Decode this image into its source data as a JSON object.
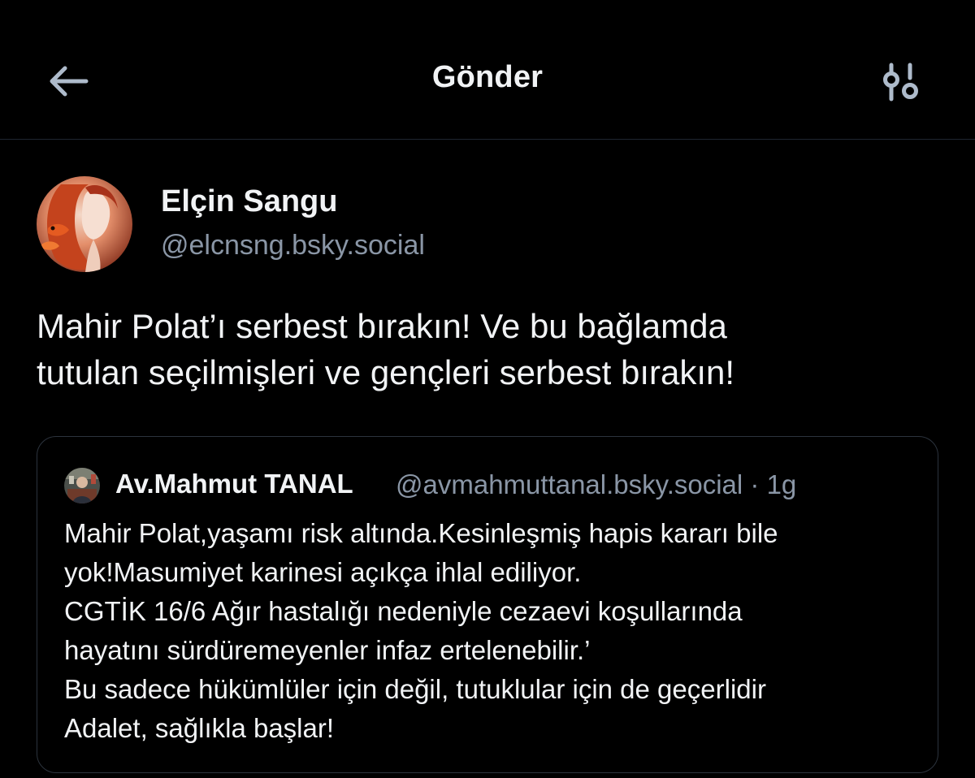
{
  "header": {
    "title": "Gönder",
    "back_icon": "arrow-left-icon",
    "settings_icon": "sliders-icon"
  },
  "post": {
    "author": {
      "display_name": "Elçin Sangu",
      "handle": "@elcnsng.bsky.social"
    },
    "text_lines": [
      "Mahir Polat’ı serbest bırakın! Ve bu bağlamda",
      "tutulan seçilmişleri ve gençleri serbest bırakın!"
    ]
  },
  "quote": {
    "author": {
      "display_name": "Av.Mahmut TANAL",
      "handle": "@avmahmuttanal.bsky.social",
      "separator": "·",
      "time": "1g"
    },
    "text_lines": [
      "Mahir Polat,yaşamı risk altında.Kesinleşmiş hapis kararı bile",
      "yok!Masumiyet karinesi açıkça ihlal ediliyor.",
      "CGTİK 16/6 Ağır hastalığı nedeniyle cezaevi koşullarında",
      "hayatını sürdüremeyenler infaz ertelenebilir.’",
      "Bu sadece hükümlüler için değil, tutuklular için de geçerlidir",
      "Adalet, sağlıkla başlar!"
    ]
  },
  "colors": {
    "background": "#000000",
    "primary_text": "#f1f3f5",
    "secondary_text": "#8a96a6",
    "border": "#2c333d",
    "icon": "#aebbcb"
  }
}
